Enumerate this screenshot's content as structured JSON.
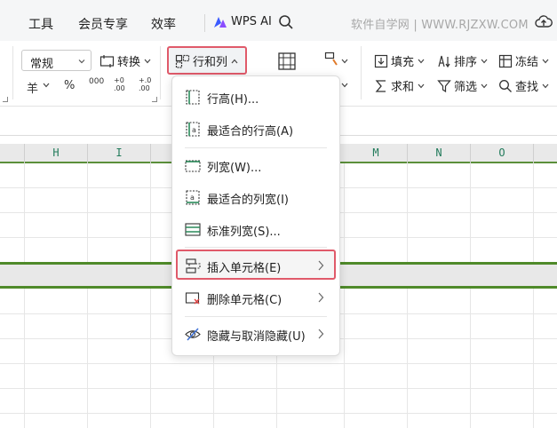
{
  "menubar": {
    "items": [
      "工具",
      "会员专享",
      "效率"
    ],
    "wps_ai": "WPS AI",
    "watermark": "软件自学网 | WWW.RJZXW.COM"
  },
  "ribbon": {
    "number_format": "常规",
    "convert_label": "转换",
    "rows_cols_label": "行和列",
    "fill_label": "填充",
    "sort_label": "排序",
    "freeze_label": "冻结",
    "sum_label": "求和",
    "filter_label": "筛选",
    "find_label": "查找",
    "currency_symbol": "羊",
    "percent_symbol": "%",
    "thousands_symbol": "000",
    "dec_increase_symbol": "+0 .00",
    "dec_decrease_symbol": "+.0 .00"
  },
  "columns": [
    "H",
    "I",
    "M",
    "N",
    "O"
  ],
  "dropdown": {
    "items": [
      {
        "label": "行高(H)...",
        "icon": "row-height-icon",
        "submenu": false
      },
      {
        "label": "最适合的行高(A)",
        "icon": "autofit-row-height-icon",
        "submenu": false
      },
      {
        "label": "列宽(W)...",
        "icon": "column-width-icon",
        "submenu": false
      },
      {
        "label": "最适合的列宽(I)",
        "icon": "autofit-column-width-icon",
        "submenu": false
      },
      {
        "label": "标准列宽(S)...",
        "icon": "standard-width-icon",
        "submenu": false
      },
      {
        "label": "插入单元格(E)",
        "icon": "insert-cells-icon",
        "submenu": true
      },
      {
        "label": "删除单元格(C)",
        "icon": "delete-cells-icon",
        "submenu": true
      },
      {
        "label": "隐藏与取消隐藏(U)",
        "icon": "hide-unhide-icon",
        "submenu": true
      }
    ]
  },
  "colors": {
    "highlight_border": "#e05a6a",
    "selection_green": "#4f8a2a",
    "column_label_color": "#217a5a"
  }
}
